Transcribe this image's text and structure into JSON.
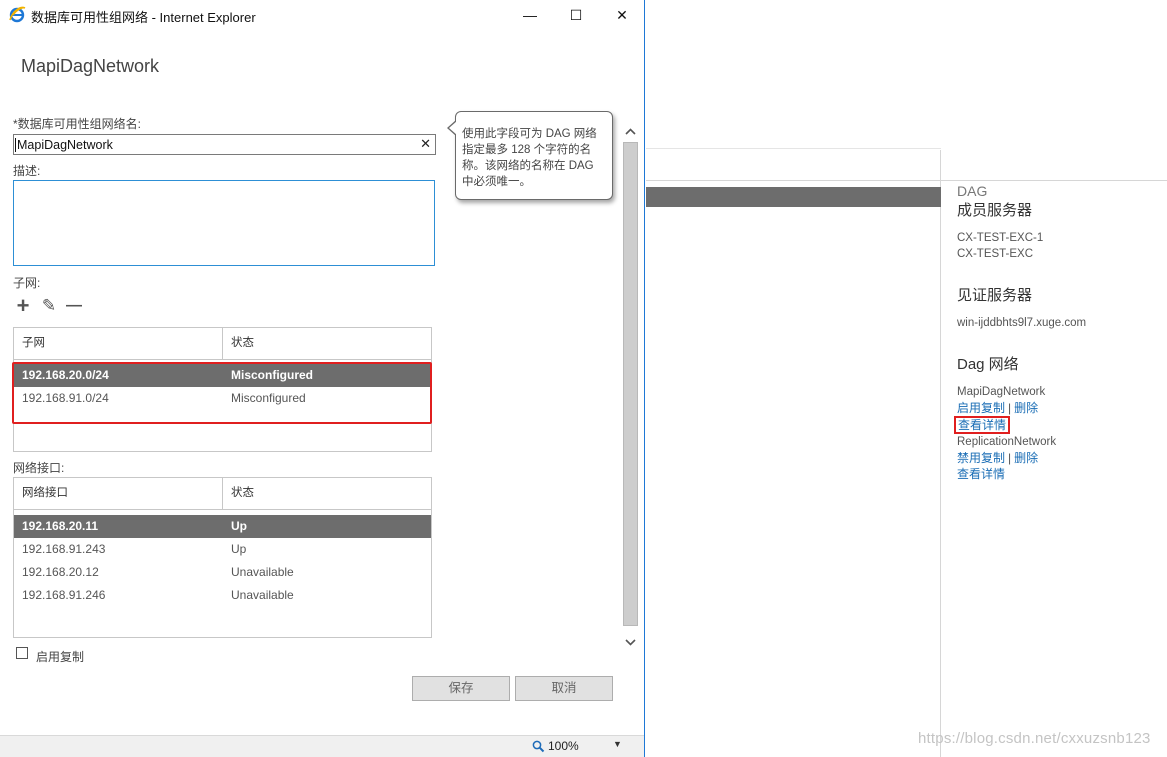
{
  "window": {
    "title": "数据库可用性组网络 - Internet Explorer",
    "minimize_glyph": "—",
    "maximize_glyph": "☐",
    "close_glyph": "✕"
  },
  "dialog": {
    "heading": "MapiDagNetwork",
    "name_label": "*数据库可用性组网络名:",
    "name_value": "MapiDagNetwork",
    "clear_glyph": "✕",
    "description_label": "描述:",
    "description_value": "",
    "tooltip_text": "使用此字段可为 DAG 网络指定最多 128 个字符的名称。该网络的名称在 DAG 中必须唯一。",
    "subnets_label": "子网:",
    "subnets_toolbar": {
      "add_glyph": "+",
      "edit_glyph": "✎",
      "remove_glyph": "—"
    },
    "subnets_table": {
      "columns": [
        "子网",
        "状态"
      ],
      "rows": [
        {
          "subnet": "192.168.20.0/24",
          "status": "Misconfigured",
          "selected": true
        },
        {
          "subnet": "192.168.91.0/24",
          "status": "Misconfigured",
          "selected": false
        }
      ]
    },
    "interfaces_label": "网络接口:",
    "interfaces_table": {
      "columns": [
        "网络接口",
        "状态"
      ],
      "rows": [
        {
          "interface": "192.168.20.11",
          "status": "Up",
          "selected": true
        },
        {
          "interface": "192.168.91.243",
          "status": "Up",
          "selected": false
        },
        {
          "interface": "192.168.20.12",
          "status": "Unavailable",
          "selected": false
        },
        {
          "interface": "192.168.91.246",
          "status": "Unavailable",
          "selected": false
        }
      ]
    },
    "replication_checkbox_label": "启用复制",
    "replication_checked": false,
    "save_label": "保存",
    "cancel_label": "取消"
  },
  "statusbar": {
    "zoom": "100%",
    "zoom_icon": "magnifier-icon"
  },
  "background_panel": {
    "category": "DAG",
    "members_heading": "成员服务器",
    "members": [
      "CX-TEST-EXC-1",
      "CX-TEST-EXC"
    ],
    "witness_heading": "见证服务器",
    "witness": "win-ijddbhts9l7.xuge.com",
    "networks_heading": "Dag 网络",
    "networks": [
      {
        "name": "MapiDagNetwork",
        "toggle_link": "启用复制",
        "separator": "|",
        "delete_link": "删除",
        "details_link": "查看详情"
      },
      {
        "name": "ReplicationNetwork",
        "toggle_link": "禁用复制",
        "separator": "|",
        "delete_link": "删除",
        "details_link": "查看详情"
      }
    ]
  },
  "watermark": "https://blog.csdn.net/cxxuzsnb123",
  "colors": {
    "accent_blue": "#1e78d6",
    "link_blue": "#1a6db5",
    "selected_row": "#6d6d6d",
    "highlight_red": "#e01f1f"
  }
}
